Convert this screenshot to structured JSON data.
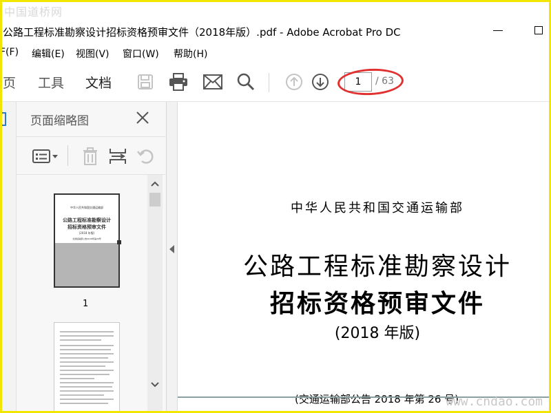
{
  "watermark": {
    "top_left": "中国道桥网",
    "bottom_right": "www.cndao.com"
  },
  "window": {
    "title": "公路工程标准勘察设计招标资格预审文件（2018年版）.pdf - Adobe Acrobat Pro DC"
  },
  "menu": [
    "F(F)",
    "编辑(E)",
    "视图(V)",
    "窗口(W)",
    "帮助(H)"
  ],
  "tabs": [
    "页",
    "工具",
    "文档"
  ],
  "toolbar": {
    "icons": [
      "save-icon",
      "print-icon",
      "email-icon",
      "search-icon",
      "page-up-icon",
      "page-down-icon"
    ],
    "page_current": "1",
    "page_total": "/ 63"
  },
  "colors": {
    "annotation": "#e03030",
    "frame": "#f2e600"
  },
  "panel": {
    "title": "页面缩略图",
    "icons": [
      "thumbnail-options-icon",
      "delete-icon",
      "insert-page-icon",
      "rotate-icon"
    ],
    "thumb1_lines": [
      "中华人民共和国交通运输部",
      "公路工程标准勘察设计",
      "招标资格预审文件",
      "(2018 年版)",
      "交通运输部公告2018年第26号"
    ],
    "thumb1_label": "1"
  },
  "document": {
    "ministry": "中华人民共和国交通运输部",
    "title_line1": "公路工程标准勘察设计",
    "title_line2": "招标资格预审文件",
    "year": "(2018 年版)",
    "bottom_partial": "(交通运输部公告 2018 年第 26 号)"
  }
}
